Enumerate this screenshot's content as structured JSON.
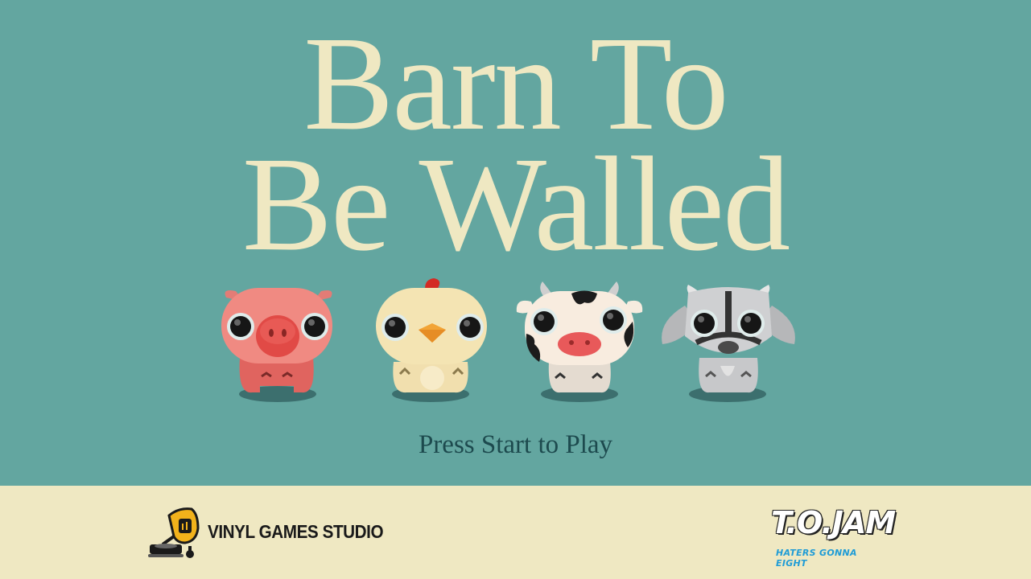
{
  "title": {
    "line1": "Barn To",
    "line2": "Be Walled"
  },
  "characters": [
    {
      "name": "pig",
      "icon": "pig-icon"
    },
    {
      "name": "chicken",
      "icon": "chicken-icon"
    },
    {
      "name": "cow",
      "icon": "cow-icon"
    },
    {
      "name": "goat",
      "icon": "goat-icon"
    }
  ],
  "prompt": "Press Start to Play",
  "footer": {
    "studio_name": "VINYL GAMES STUDIO",
    "studio_icon": "gramophone-controller-icon",
    "jam_title": "T.O.JAM",
    "jam_subtitle": "HATERS GONNA EIGHT"
  },
  "colors": {
    "background": "#63a6a0",
    "title": "#efe8c2",
    "prompt": "#1d4a4e",
    "footer": "#efe8c2"
  }
}
